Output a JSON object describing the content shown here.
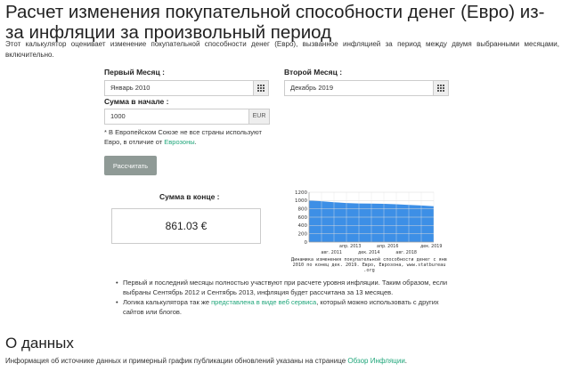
{
  "page": {
    "title": "Расчет изменения покупательной способности денег (Евро) из-за инфляции за произвольный период",
    "intro": "Этот калькулятор оценивает изменение покупательной способности денег (Евро), вызванное инфляцией за период между двумя выбранными месяцами, включительно."
  },
  "form": {
    "first_month_label": "Первый Месяц :",
    "first_month_value": "Январь 2010",
    "second_month_label": "Второй Месяц :",
    "second_month_value": "Декабрь 2019",
    "start_amount_label": "Сумма в начале :",
    "start_amount_value": "1000",
    "currency": "EUR",
    "note_text": "* В Европейском Союзе не все страны используют Евро, в отличие от ",
    "note_link": "Еврозоны",
    "note_end": ".",
    "calculate_button": "Рассчитать"
  },
  "result": {
    "label": "Сумма в конце :",
    "value": "861.03 €"
  },
  "chart_data": {
    "type": "area",
    "color": "#3d8fe6",
    "y_ticks": [
      "1200",
      "1000",
      "800",
      "600",
      "400",
      "200",
      "0"
    ],
    "ylim": [
      0,
      1200
    ],
    "x_ticks_top": [
      "апр. 2013",
      "апр. 2016",
      "дек. 2019"
    ],
    "x_ticks_bottom": [
      "авг. 2011",
      "дек. 2014",
      "авг. 2018"
    ],
    "x": [
      "2010-01",
      "2011-01",
      "2012-01",
      "2013-01",
      "2014-01",
      "2015-01",
      "2016-01",
      "2017-01",
      "2018-01",
      "2019-01",
      "2019-12"
    ],
    "values": [
      1000,
      983,
      960,
      940,
      930,
      925,
      922,
      910,
      895,
      880,
      861
    ],
    "grid": true,
    "caption": "Динамика изменения покупательной способности денег с янв 2010 по конец дек. 2019. Евро, Еврозона, www.statbureau .org"
  },
  "bullets": [
    {
      "text": "Первый и последний месяцы полностью участвуют при расчете уровня инфляции. Таким образом, если выбраны Сентябрь 2012 и Сентябрь 2013, инфляция будет рассчитана за 13 месяцев."
    },
    {
      "pre": "Логика калькулятора так же ",
      "link": "представлена в виде веб сервиса",
      "post": ", который можно использовать с других сайтов или блогов."
    }
  ],
  "about": {
    "heading": "О данных",
    "text": "Информация об источнике данных и примерный график публикации обновлений указаны на странице ",
    "link": "Обзор Инфляции",
    "end": "."
  },
  "icons": {
    "calendar": "calendar-icon"
  }
}
